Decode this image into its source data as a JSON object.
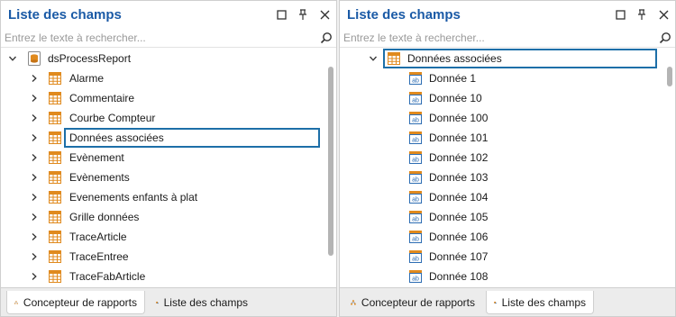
{
  "colors": {
    "title": "#1a5aa6",
    "focus_border": "#1d6fa8",
    "table_icon_orange": "#e08a1e",
    "field_icon_blue": "#2d6db3"
  },
  "left_panel": {
    "title": "Liste des champs",
    "search_placeholder": "Entrez le texte à rechercher...",
    "root": {
      "label": "dsProcessReport",
      "icon": "datasource-icon",
      "expanded": true
    },
    "items": [
      {
        "label": "Alarme",
        "icon": "table-icon"
      },
      {
        "label": "Commentaire",
        "icon": "table-icon"
      },
      {
        "label": "Courbe Compteur",
        "icon": "table-icon"
      },
      {
        "label": "Données associées",
        "icon": "table-icon",
        "focused": true
      },
      {
        "label": "Evènement",
        "icon": "table-icon"
      },
      {
        "label": "Evènements",
        "icon": "table-icon"
      },
      {
        "label": "Evenements enfants à plat",
        "icon": "table-icon"
      },
      {
        "label": "Grille données",
        "icon": "table-icon"
      },
      {
        "label": "TraceArticle",
        "icon": "table-icon"
      },
      {
        "label": "TraceEntree",
        "icon": "table-icon"
      },
      {
        "label": "TraceFabArticle",
        "icon": "table-icon"
      }
    ],
    "tabs": [
      {
        "label": "Concepteur de rapports",
        "icon": "hierarchy-icon",
        "active": true
      },
      {
        "label": "Liste des champs",
        "icon": "database-icon",
        "active": false
      }
    ]
  },
  "right_panel": {
    "title": "Liste des champs",
    "search_placeholder": "Entrez le texte à rechercher...",
    "root": {
      "label": "Données associées",
      "icon": "table-icon",
      "expanded": true,
      "focused": true
    },
    "items": [
      {
        "label": "Donnée 1",
        "icon": "text-field-icon"
      },
      {
        "label": "Donnée 10",
        "icon": "text-field-icon"
      },
      {
        "label": "Donnée 100",
        "icon": "text-field-icon"
      },
      {
        "label": "Donnée 101",
        "icon": "text-field-icon"
      },
      {
        "label": "Donnée 102",
        "icon": "text-field-icon"
      },
      {
        "label": "Donnée 103",
        "icon": "text-field-icon"
      },
      {
        "label": "Donnée 104",
        "icon": "text-field-icon"
      },
      {
        "label": "Donnée 105",
        "icon": "text-field-icon"
      },
      {
        "label": "Donnée 106",
        "icon": "text-field-icon"
      },
      {
        "label": "Donnée 107",
        "icon": "text-field-icon"
      },
      {
        "label": "Donnée 108",
        "icon": "text-field-icon"
      }
    ],
    "tabs": [
      {
        "label": "Concepteur de rapports",
        "icon": "hierarchy-icon",
        "active": false
      },
      {
        "label": "Liste des champs",
        "icon": "database-icon",
        "active": true
      }
    ]
  }
}
